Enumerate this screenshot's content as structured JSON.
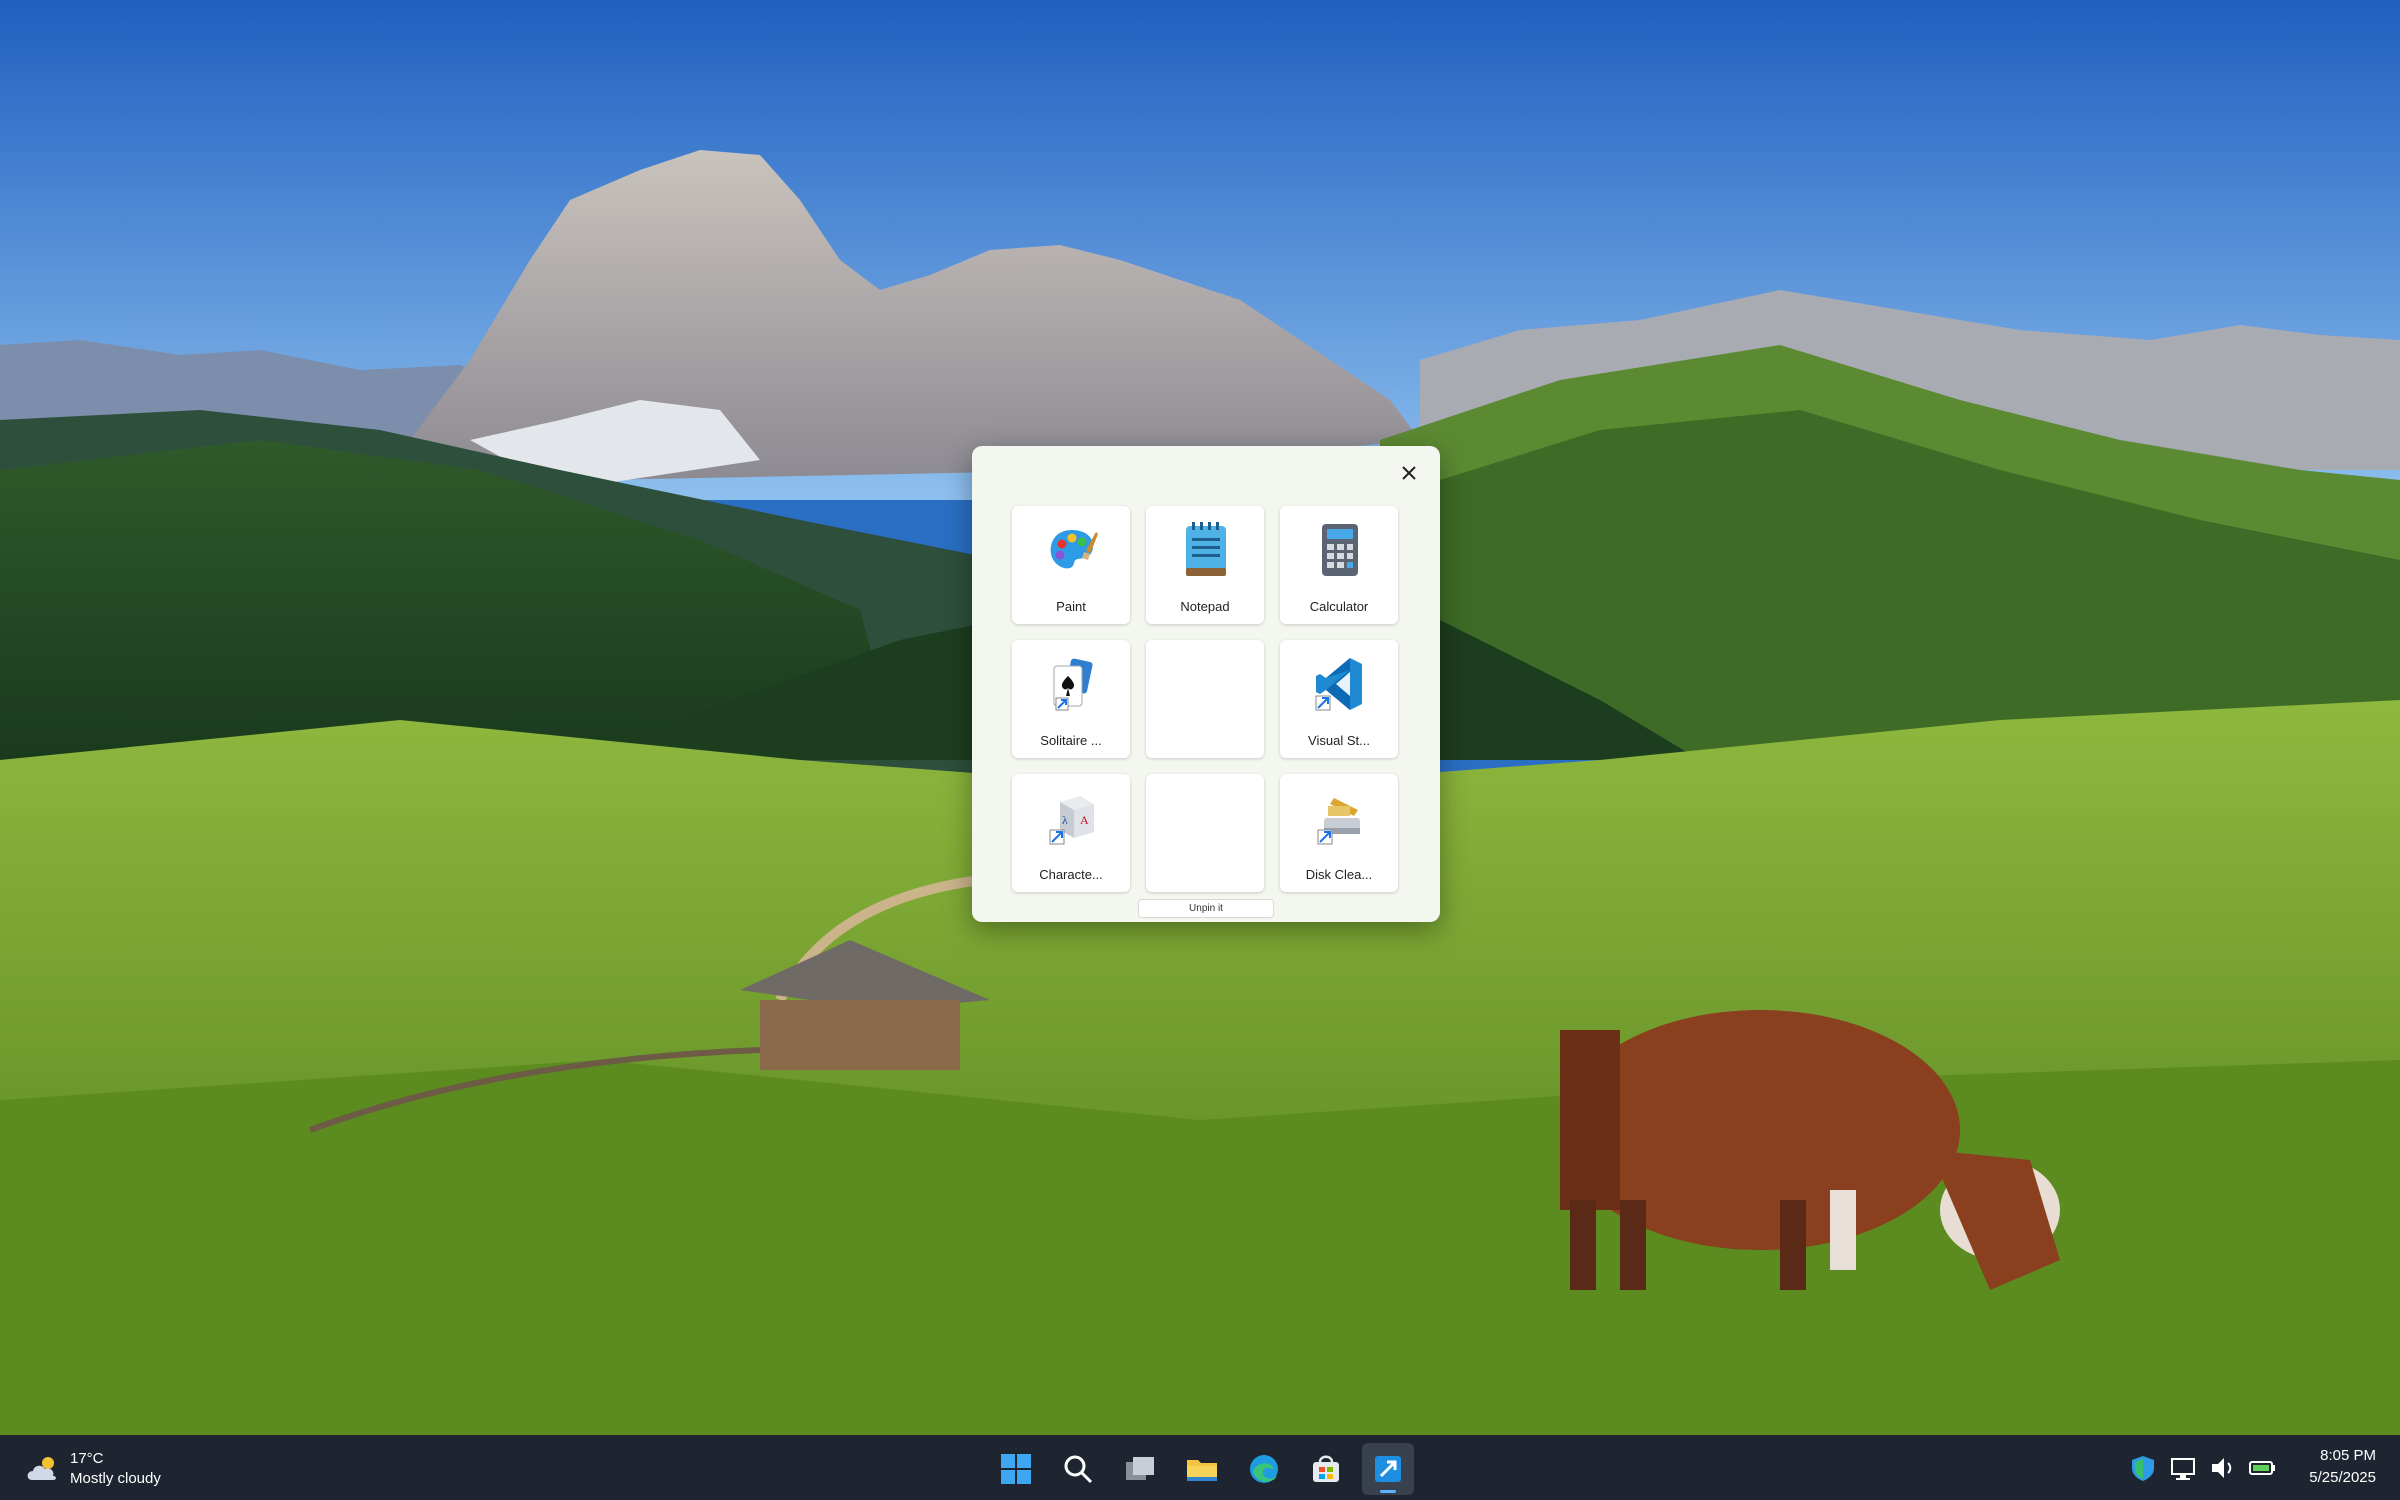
{
  "launcher": {
    "close_icon": "close-icon",
    "apps": [
      {
        "label": "Paint",
        "icon": "paint-icon"
      },
      {
        "label": "Notepad",
        "icon": "notepad-icon"
      },
      {
        "label": "Calculator",
        "icon": "calculator-icon"
      },
      {
        "label": "Solitaire ...",
        "icon": "solitaire-icon"
      },
      {
        "label": "",
        "icon": ""
      },
      {
        "label": "Visual St...",
        "icon": "vscode-icon"
      },
      {
        "label": "Characte...",
        "icon": "character-map-icon"
      },
      {
        "label": "",
        "icon": ""
      },
      {
        "label": "Disk Clea...",
        "icon": "disk-cleanup-icon"
      }
    ],
    "unpin_label": "Unpin it"
  },
  "taskbar": {
    "weather": {
      "temp": "17°C",
      "condition": "Mostly cloudy"
    },
    "apps": [
      "start-icon",
      "search-icon",
      "task-view-icon",
      "file-explorer-icon",
      "edge-icon",
      "store-icon",
      "pinned-launcher-icon"
    ],
    "tray": [
      "security-icon",
      "network-icon",
      "volume-icon",
      "battery-icon"
    ],
    "clock": {
      "time": "8:05 PM",
      "date": "5/25/2025"
    }
  },
  "colors": {
    "accent": "#5fb2ff",
    "taskbar": "#1f2530",
    "panel": "#f4f6f0"
  }
}
